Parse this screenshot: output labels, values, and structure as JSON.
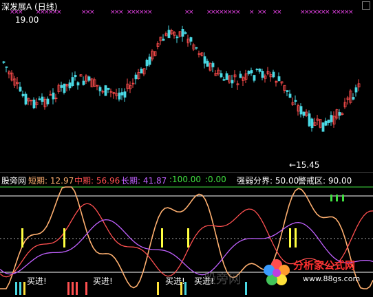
{
  "header": {
    "stock_name": "深发展A",
    "period": "(日线)",
    "price_high_label": "19.00",
    "price_low_label": "15.45"
  },
  "indicator": {
    "name": "股旁网",
    "short_label": "短期:",
    "short_value": "12.97",
    "mid_label": "中期:",
    "mid_value": "56.96",
    "long_label": "长期:",
    "long_value": "41.87",
    "v1": ":100.00",
    "v2": ":0.00",
    "strength_label": "强弱分界:",
    "strength_value": "50.00",
    "alert_label": "警戒区:",
    "alert_value": "90.00"
  },
  "signals": [
    "买进",
    "买进",
    "买进",
    "买进"
  ],
  "watermark": "股旁网",
  "logo": {
    "text": "分析家公式网",
    "url": "www.88gs.com"
  },
  "colors": {
    "up": "#ff4d4d",
    "down": "#4ad9e4",
    "short": "#ffb070",
    "mid": "#ff5050",
    "long": "#c060ff",
    "green": "#40e040",
    "marker": "#ee44ee",
    "signal": "#ffff40"
  }
}
